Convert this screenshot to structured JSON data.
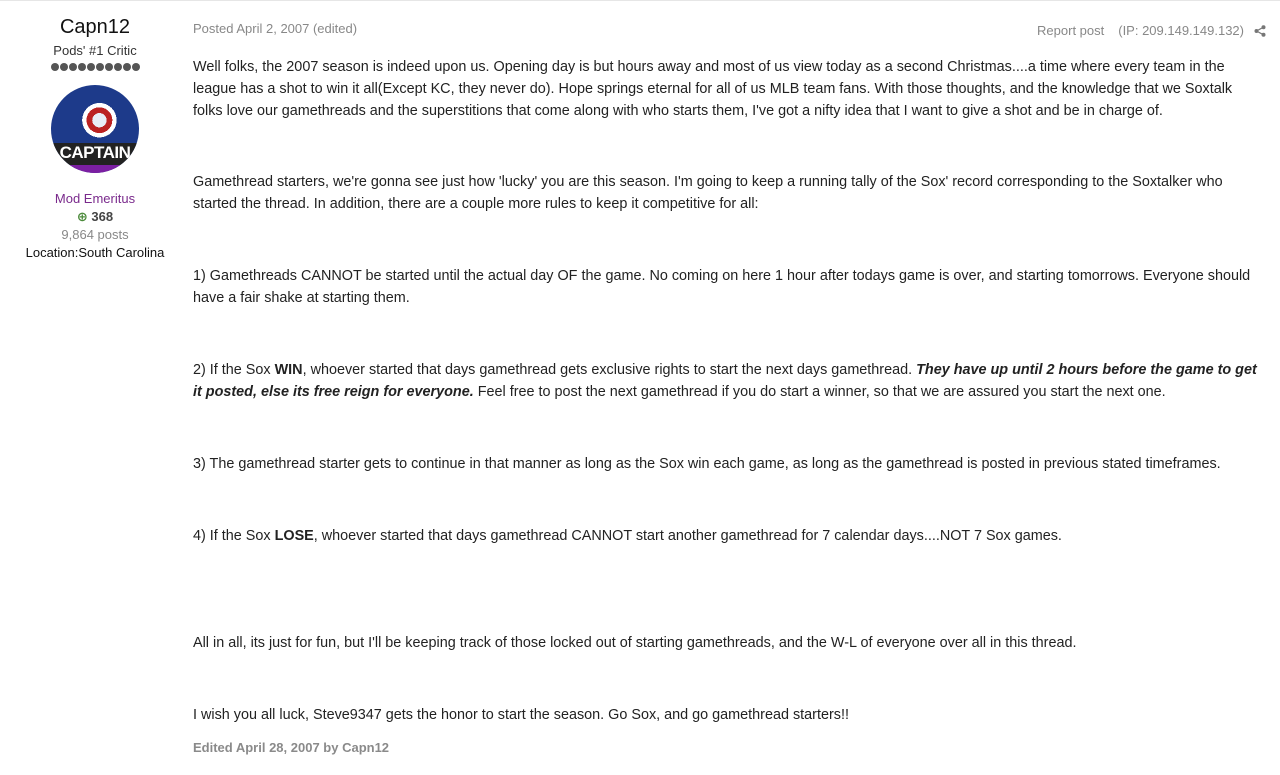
{
  "author": {
    "name": "Capn12",
    "title": "Pods' #1 Critic",
    "pip_count": 10,
    "avatar_text": "CAPTAIN",
    "group": "Mod Emeritus",
    "reputation": "368",
    "posts": "9,864 posts",
    "location": "Location:South Carolina"
  },
  "post": {
    "posted": "Posted April 2, 2007 (edited)",
    "report": "Report post",
    "ip": "(IP: 209.149.149.132)",
    "share_icon": "share-icon",
    "p1": "Well folks, the 2007 season is indeed upon us. Opening day is but hours away and most of us view today as a second Christmas....a time where every team in the league has a shot to win it all(Except KC, they never do). Hope springs eternal for all of us MLB team fans. With those thoughts, and the knowledge that we Soxtalk folks love our gamethreads and the superstitions that come along with who starts them, I've got a nifty idea that I want to give a shot and be in charge of.",
    "p2": "Gamethread starters, we're gonna see just how 'lucky' you are this season. I'm going to keep a running tally of the Sox' record corresponding to the Soxtalker who started the thread. In addition, there are a couple more rules to keep it competitive for all:",
    "p3": "1) Gamethreads CANNOT be started until the actual day OF the game. No coming on here 1 hour after todays game is over, and starting tomorrows. Everyone should have a fair shake at starting them.",
    "p4_a": "2) If the Sox ",
    "p4_b": "WIN",
    "p4_c": ", whoever started that days gamethread gets exclusive rights to start the next days gamethread. ",
    "p4_d": "They have up until 2 hours before the game to get it posted, else its free reign for everyone.",
    "p4_e": " Feel free to post the next gamethread if you do start a winner, so that we are assured you start the next one.",
    "p5": "3) The gamethread starter gets to continue in that manner as long as the Sox win each game, as long as the gamethread is posted in previous stated timeframes.",
    "p6_a": "4) If the Sox ",
    "p6_b": "LOSE",
    "p6_c": ", whoever started that days gamethread CANNOT start another gamethread for 7 calendar days....NOT 7 Sox games.",
    "p7": "All in all, its just for fun, but I'll be keeping track of those locked out of starting gamethreads, and the W-L of everyone over all in this thread.",
    "p8": "I wish you all luck, Steve9347 gets the honor to start the season. Go Sox, and go gamethread starters!!",
    "edited": "Edited April 28, 2007 by Capn12"
  }
}
